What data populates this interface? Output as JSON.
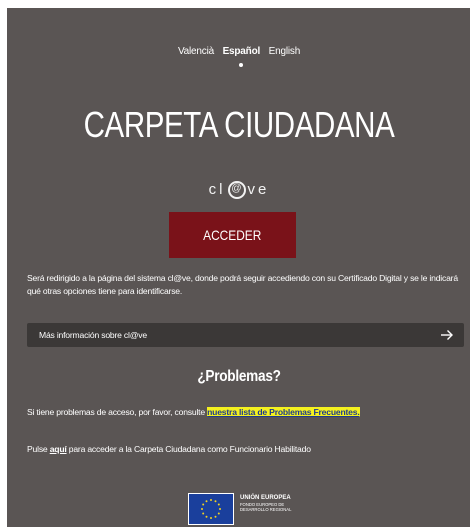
{
  "languages": {
    "valencia": "Valencià",
    "espanol": "Español",
    "english": "English"
  },
  "title": "CARPETA CIUDADANA",
  "clave_logo": {
    "prefix": "cl",
    "at": "@",
    "suffix": "ve"
  },
  "acceder_button": "ACCEDER",
  "redirect_text": "Será redirigido a la página del sistema cl@ve, donde podrá seguir accediendo con su Certificado Digital y se le indicará qué otras opciones tiene para identificarse.",
  "info_bar": {
    "label": "Más información sobre cl@ve",
    "icon": "arrow-right-icon"
  },
  "problems": {
    "title": "¿Problemas?",
    "text_before": "Si tiene problemas de acceso, por favor, consulte ",
    "link": "nuestra lista de Problemas Frecuentes."
  },
  "funcionario": {
    "text_before": "Pulse ",
    "link": "aquí",
    "text_after": " para acceder a la Carpeta Ciudadana como Funcionario Habilitado"
  },
  "eu_logo": {
    "line1": "UNIÓN EUROPEA",
    "line2": "FONDO EUROPEO DE",
    "line3": "DESARROLLO REGIONAL"
  },
  "colors": {
    "background": "#5a5554",
    "button": "#7a1219",
    "info_bar": "#3b3837",
    "link_highlight": "#f4f11f",
    "eu_flag": "#1a3f9c"
  }
}
